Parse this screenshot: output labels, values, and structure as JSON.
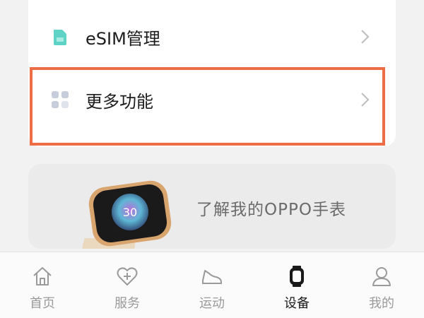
{
  "settings": {
    "items": [
      {
        "label": "eSIM管理",
        "icon": "sim-card-icon"
      },
      {
        "label": "更多功能",
        "icon": "grid-apps-icon"
      }
    ]
  },
  "banner": {
    "text": "了解我的OPPO手表",
    "watch_time": "30"
  },
  "tabbar": {
    "tabs": [
      {
        "label": "首页",
        "icon": "home-icon",
        "active": false
      },
      {
        "label": "服务",
        "icon": "heart-plus-icon",
        "active": false
      },
      {
        "label": "运动",
        "icon": "shoe-icon",
        "active": false
      },
      {
        "label": "设备",
        "icon": "watch-icon",
        "active": true
      },
      {
        "label": "我的",
        "icon": "person-icon",
        "active": false
      }
    ]
  },
  "colors": {
    "highlight": "#ef6d45",
    "sim_icon": "#5fd4c6",
    "grid_icon": "#c7cdda",
    "active_tab": "#1a1a1a",
    "inactive_tab": "#9a9a9a"
  }
}
